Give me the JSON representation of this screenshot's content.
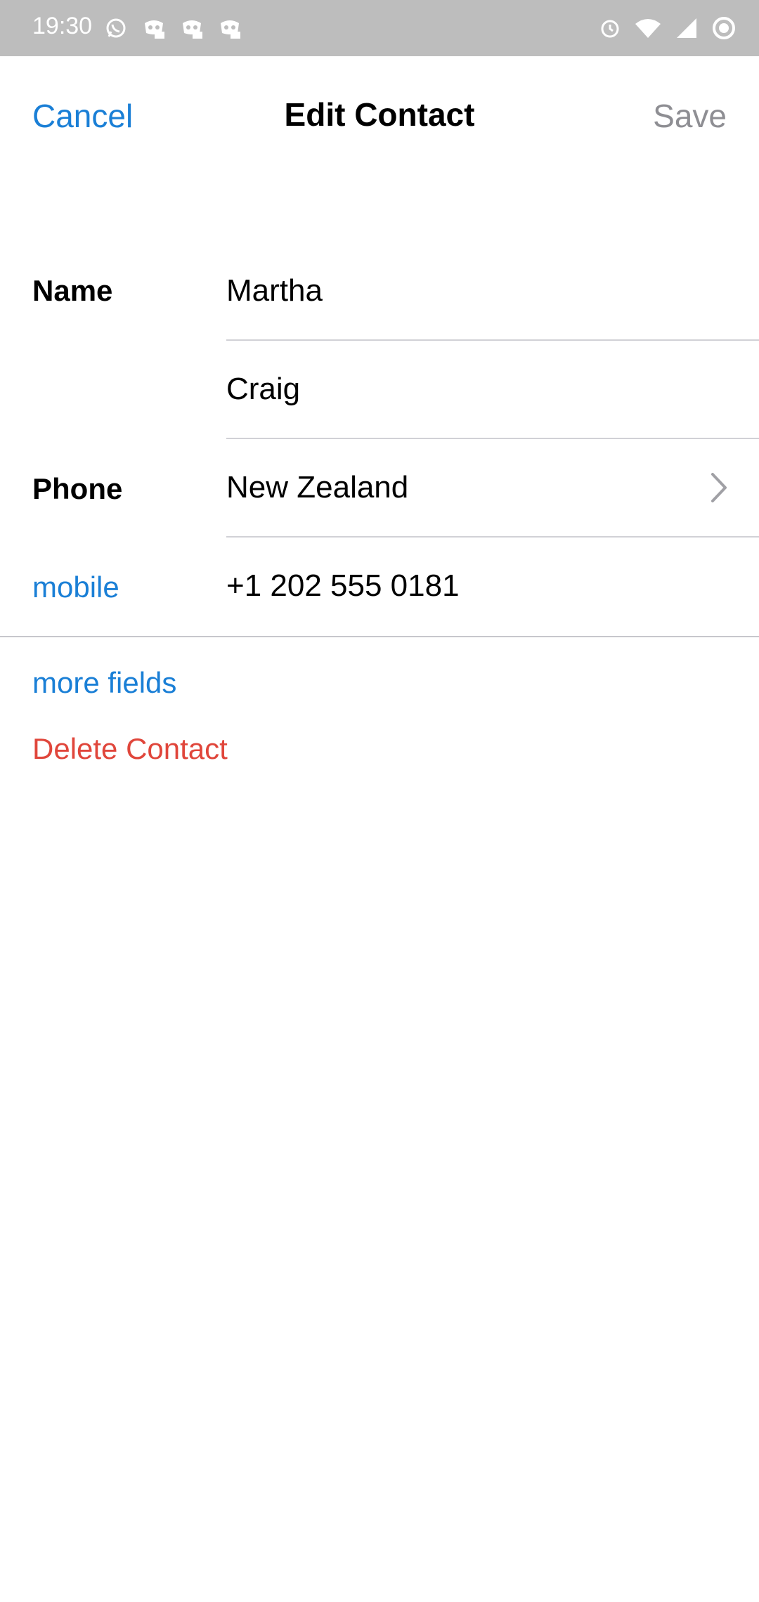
{
  "status_bar": {
    "time": "19:30",
    "left_icons": [
      "whatsapp-icon",
      "discord-icon",
      "discord-icon",
      "discord-icon"
    ],
    "right_icons": [
      "alarm-icon",
      "wifi-icon",
      "signal-icon",
      "battery-icon"
    ]
  },
  "nav": {
    "cancel_label": "Cancel",
    "title": "Edit Contact",
    "save_label": "Save"
  },
  "form": {
    "name_label": "Name",
    "first_name": "Martha",
    "last_name": "Craig",
    "phone_label": "Phone",
    "country": "New Zealand",
    "phone_type": "mobile",
    "phone_number": "+1 202 555 0181"
  },
  "actions": {
    "more_fields": "more fields",
    "delete_contact": "Delete Contact"
  },
  "colors": {
    "accent": "#1a7fd6",
    "destructive": "#e0463b",
    "disabled": "#8e8e93",
    "status_bar_bg": "#bdbdbd"
  }
}
